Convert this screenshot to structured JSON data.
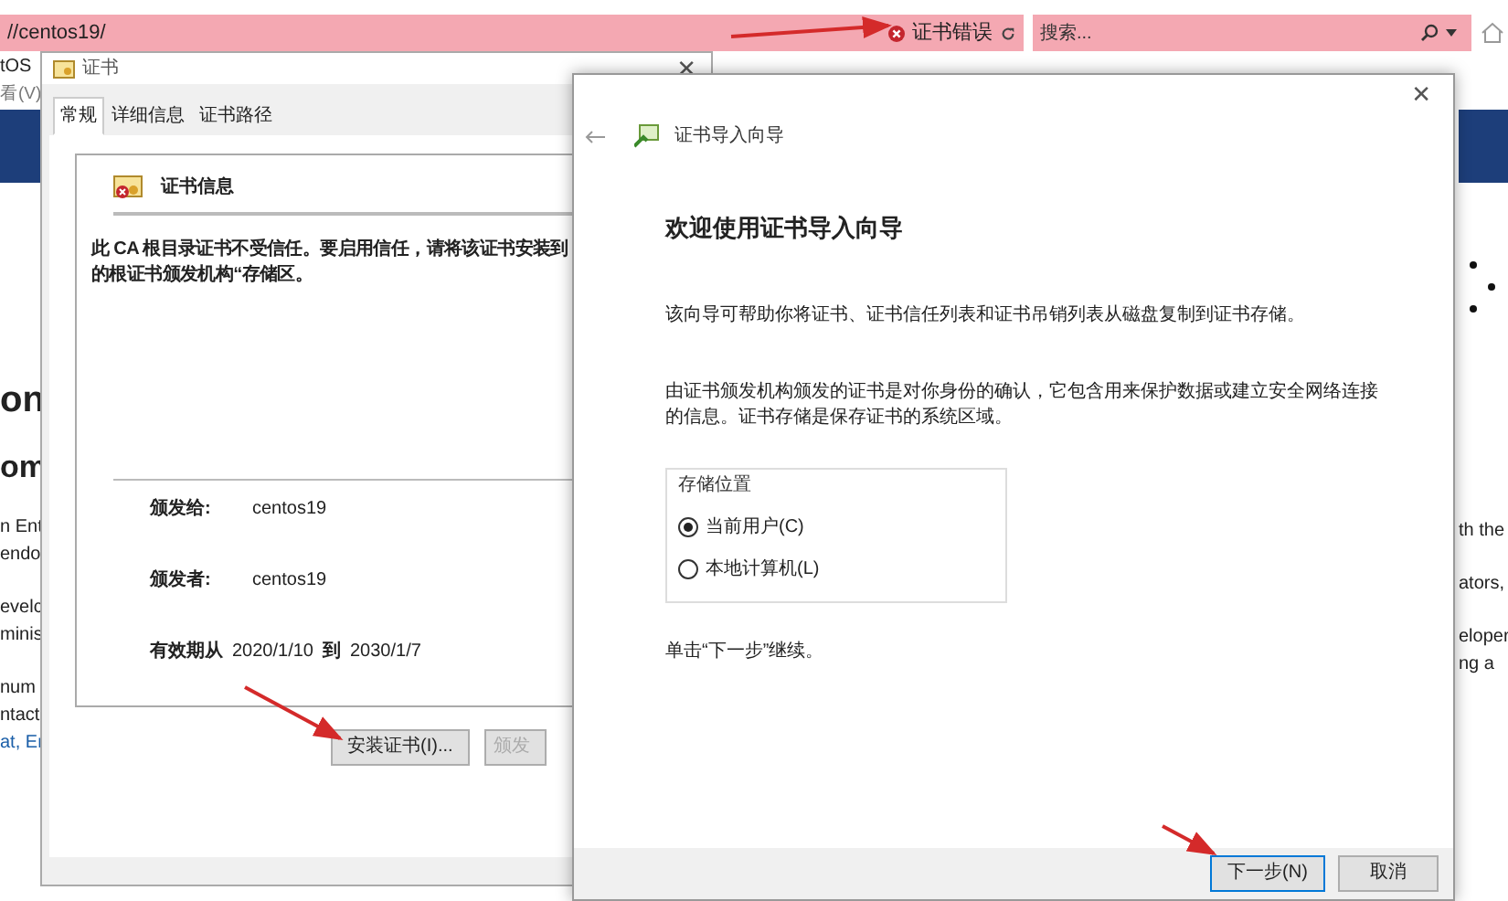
{
  "browser": {
    "address": "//centos19/",
    "cert_error": "证书错误",
    "search_placeholder": "搜索...",
    "tab": "tOS",
    "menu": "看(V)"
  },
  "page_left": [
    {
      "kind": "heading",
      "text": "on"
    },
    {
      "kind": "subheading",
      "text": "om"
    },
    {
      "kind": "text",
      "text": "n Ent"
    },
    {
      "kind": "text",
      "text": "endo"
    },
    {
      "kind": "gap"
    },
    {
      "kind": "text",
      "text": "evelc"
    },
    {
      "kind": "text",
      "text": "minis"
    },
    {
      "kind": "gap"
    },
    {
      "kind": "text",
      "text": "num"
    },
    {
      "kind": "text",
      "text": "ntact"
    },
    {
      "kind": "link",
      "text": "at, Er"
    }
  ],
  "page_right": [
    {
      "kind": "text",
      "text": "th the"
    },
    {
      "kind": "gap"
    },
    {
      "kind": "text",
      "text": "ators,"
    },
    {
      "kind": "gap"
    },
    {
      "kind": "text",
      "text": "eloper"
    },
    {
      "kind": "text",
      "text": "ng a"
    }
  ],
  "cert_dialog": {
    "title": "证书",
    "close": "✕",
    "tabs": [
      {
        "label": "常规",
        "selected": true
      },
      {
        "label": "详细信息",
        "selected": false
      },
      {
        "label": "证书路径",
        "selected": false
      }
    ],
    "info_title": "证书信息",
    "warning": [
      "此 CA 根目录证书不受信任。要启用信任，请将该证书安装到",
      "的根证书颁发机构“存储区。"
    ],
    "fields": [
      {
        "label": "颁发给:",
        "value": "centos19"
      },
      {
        "label": "颁发者:",
        "value": "centos19"
      }
    ],
    "validity": {
      "label": "有效期从",
      "from": "2020/1/10",
      "to_label": "到",
      "to": "2030/1/7"
    },
    "buttons": [
      {
        "label": "安装证书(I)...",
        "disabled": false
      },
      {
        "label": "颁发",
        "disabled": true
      }
    ]
  },
  "wizard": {
    "title": "证书导入向导",
    "close": "✕",
    "heading": "欢迎使用证书导入向导",
    "paragraphs": [
      "该向导可帮助你将证书、证书信任列表和证书吊销列表从磁盘复制到证书存储。",
      "由证书颁发机构颁发的证书是对你身份的确认，它包含用来保护数据或建立安全网络连接的信息。证书存储是保存证书的系统区域。"
    ],
    "store_label": "存储位置",
    "options": [
      {
        "label": "当前用户(C)",
        "selected": true
      },
      {
        "label": "本地计算机(L)",
        "selected": false
      }
    ],
    "note": "单击“下一步”继续。",
    "buttons": [
      {
        "label": "下一步(N)",
        "primary": true
      },
      {
        "label": "取消",
        "primary": false
      }
    ]
  }
}
